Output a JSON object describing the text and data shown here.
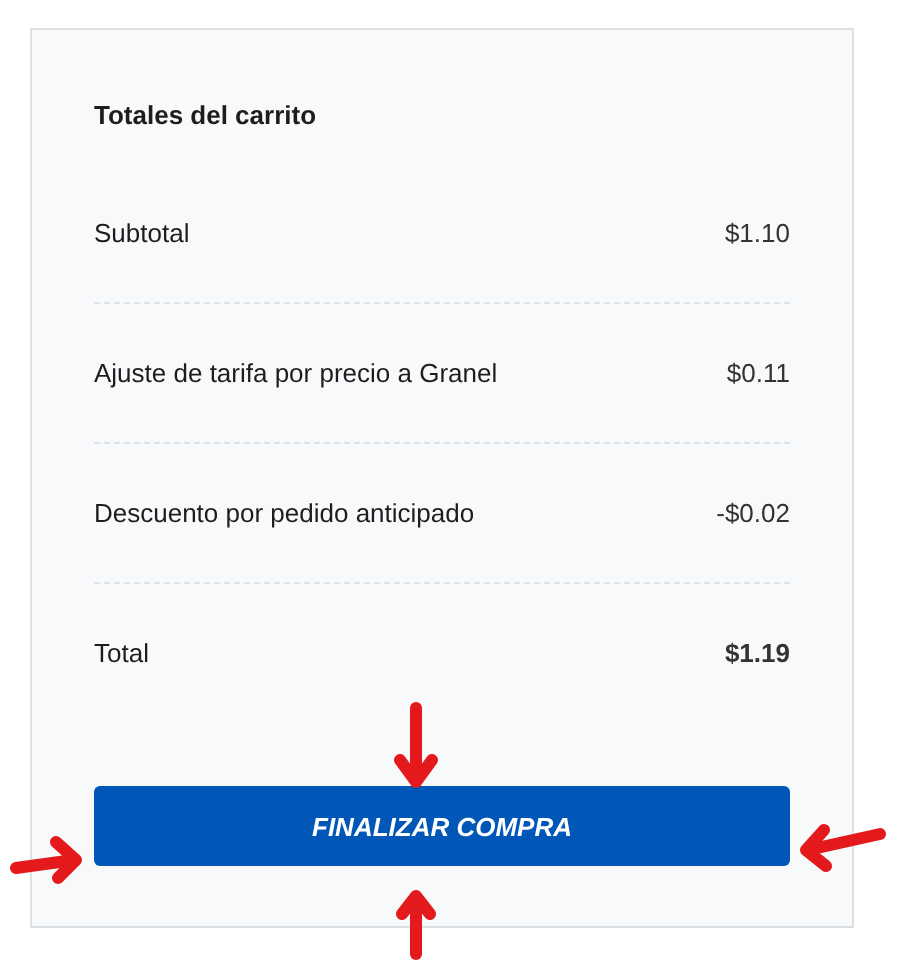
{
  "cart_totals": {
    "title": "Totales del carrito",
    "rows": [
      {
        "kind": "line",
        "label": "Subtotal",
        "amount": "$1.10"
      },
      {
        "kind": "line",
        "label": "Ajuste de tarifa por precio a Granel",
        "amount": "$0.11"
      },
      {
        "kind": "line",
        "label": "Descuento por pedido anticipado",
        "amount": "-$0.02"
      },
      {
        "kind": "total",
        "label": "Total",
        "amount": "$1.19"
      }
    ],
    "checkout_button": "FINALIZAR COMPRA"
  }
}
